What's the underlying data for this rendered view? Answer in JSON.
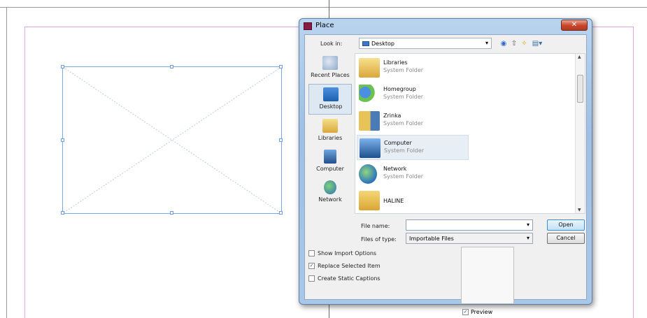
{
  "dialog": {
    "title": "Place",
    "close_glyph": "✕",
    "look_in": {
      "label": "Look in:",
      "value": "Desktop",
      "arrow": "▾"
    },
    "toolbar": {
      "back_glyph": "◉",
      "up_glyph": "⇧",
      "new_folder_glyph": "✧",
      "views_glyph": "▤▾"
    },
    "places": [
      {
        "label": "Recent Places",
        "icon": "recent-places-icon",
        "selected": false
      },
      {
        "label": "Desktop",
        "icon": "desktop-icon",
        "selected": true
      },
      {
        "label": "Libraries",
        "icon": "libraries-icon",
        "selected": false
      },
      {
        "label": "Computer",
        "icon": "computer-icon",
        "selected": false
      },
      {
        "label": "Network",
        "icon": "network-icon",
        "selected": false
      }
    ],
    "files": [
      {
        "name": "Libraries",
        "type": "System Folder",
        "icon": "libraries-folder-icon"
      },
      {
        "name": "Homegroup",
        "type": "System Folder",
        "icon": "homegroup-icon"
      },
      {
        "name": "Zrinka",
        "type": "System Folder",
        "icon": "user-folder-icon"
      },
      {
        "name": "Computer",
        "type": "System Folder",
        "icon": "computer-icon",
        "highlighted": true
      },
      {
        "name": "Network",
        "type": "System Folder",
        "icon": "network-globe-icon"
      },
      {
        "name": "HALINE",
        "type": "",
        "icon": "folder-icon"
      }
    ],
    "file_name": {
      "label": "File name:",
      "value": "",
      "arrow": "▾"
    },
    "file_type": {
      "label": "Files of type:",
      "value": "Importable Files",
      "arrow": "▾"
    },
    "buttons": {
      "open": "Open",
      "cancel": "Cancel"
    },
    "options": [
      {
        "label": "Show Import Options",
        "checked": false
      },
      {
        "label": "Replace Selected Item",
        "checked": true
      },
      {
        "label": "Create Static Captions",
        "checked": false
      }
    ],
    "preview": {
      "label": "Preview",
      "checked": true
    },
    "check_glyph": "✓"
  },
  "colors": {
    "frame_stroke": "#7aa7e6",
    "margin_guide": "#e4a4e4",
    "dialog_chrome": "#a9c7e8",
    "close_button": "#c8442a",
    "app_icon": "#8a1c44"
  }
}
